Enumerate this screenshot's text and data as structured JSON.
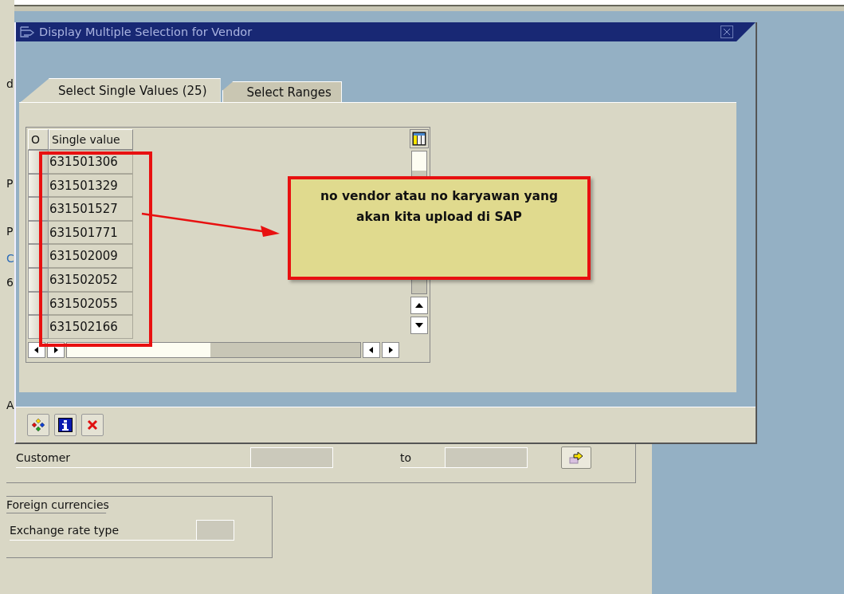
{
  "window": {
    "title": "Display Multiple Selection for Vendor"
  },
  "tabs": [
    {
      "label": "Select Single Values (25)",
      "selected": true
    },
    {
      "label": "Select Ranges",
      "selected": false
    }
  ],
  "table": {
    "columns": [
      "O",
      "Single value"
    ],
    "rows": [
      {
        "value": "631501306"
      },
      {
        "value": "631501329"
      },
      {
        "value": "631501527"
      },
      {
        "value": "631501771"
      },
      {
        "value": "631502009"
      },
      {
        "value": "631502052"
      },
      {
        "value": "631502055"
      },
      {
        "value": "631502166"
      }
    ]
  },
  "footer_buttons": [
    {
      "kind": "execute"
    },
    {
      "kind": "info"
    },
    {
      "kind": "cancel"
    }
  ],
  "annotation": {
    "text": "no vendor atau no karyawan yang akan kita upload di SAP"
  },
  "background": {
    "fragments": [
      "d",
      "P",
      "P",
      "C",
      "6",
      "A"
    ],
    "customer": {
      "label": "Customer",
      "to_label": "to"
    },
    "foreign_currencies": {
      "title": "Foreign currencies",
      "field_label": "Exchange rate type"
    }
  }
}
